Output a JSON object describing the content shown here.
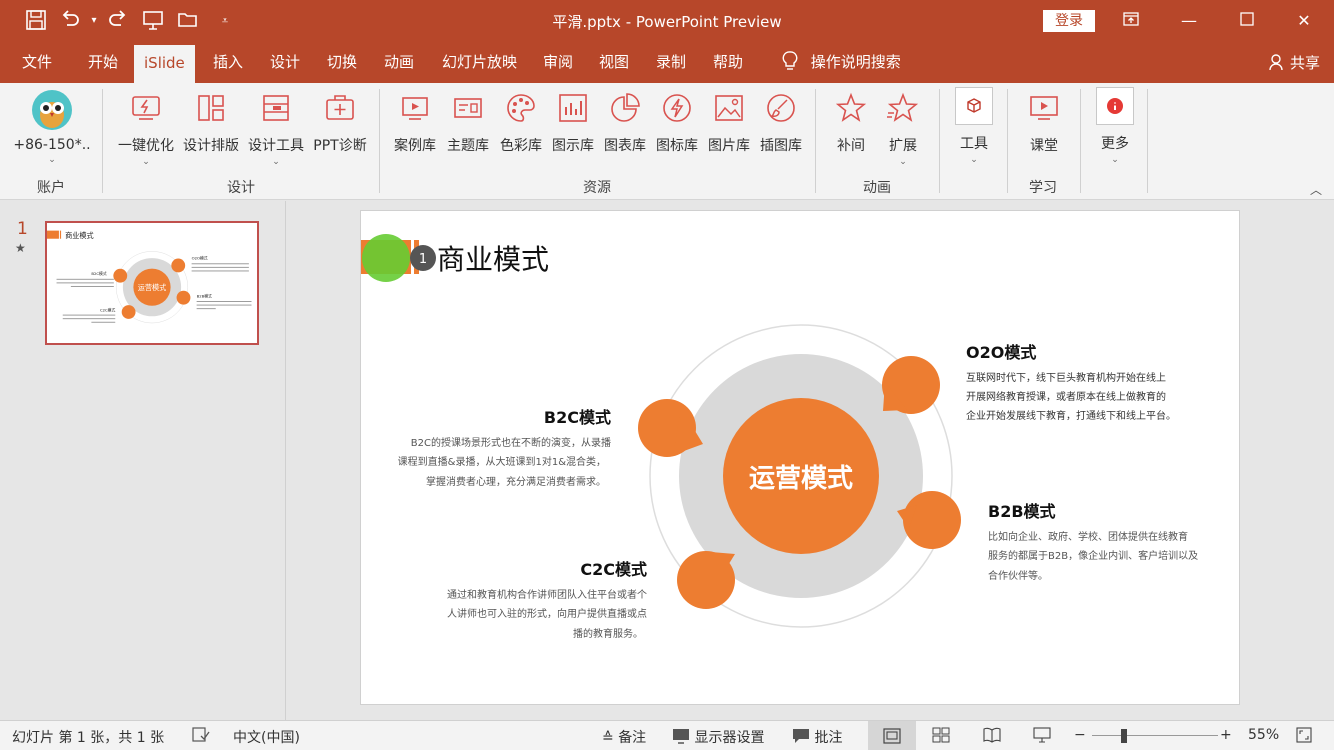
{
  "window": {
    "doc_title": "平滑.pptx  -  PowerPoint Preview",
    "login": "登录"
  },
  "tabs": [
    "文件",
    "开始",
    "iSlide",
    "插入",
    "设计",
    "切换",
    "动画",
    "幻灯片放映",
    "审阅",
    "视图",
    "录制",
    "帮助"
  ],
  "tell_me": "操作说明搜索",
  "share": "共享",
  "ribbon": {
    "account": {
      "label": "+86-150*..",
      "group": "账户"
    },
    "design": {
      "buttons": [
        "一键优化",
        "设计排版",
        "设计工具",
        "PPT诊断"
      ],
      "group": "设计"
    },
    "resources": {
      "buttons": [
        "案例库",
        "主题库",
        "色彩库",
        "图示库",
        "图表库",
        "图标库",
        "图片库",
        "插图库"
      ],
      "group": "资源"
    },
    "animation": {
      "buttons": [
        "补间",
        "扩展"
      ],
      "group": "动画"
    },
    "tools": {
      "label": "工具"
    },
    "learn": {
      "label": "课堂",
      "group": "学习"
    },
    "more": {
      "label": "更多"
    }
  },
  "thumbnail": {
    "number": "1",
    "title": "商业模式",
    "center": "运营模式",
    "labels": [
      "B2C模式",
      "O2O模式",
      "C2C模式",
      "B2B模式"
    ]
  },
  "slide": {
    "title": "商业模式",
    "anim_badge": "1",
    "center": "运营模式",
    "b2c": {
      "title": "B2C模式",
      "lines": [
        "B2C的授课场景形式也在不断的演变，从录播",
        "课程到直播&录播，从大班课到1对1&混合类，",
        "掌握消费者心理，充分满足消费者需求。"
      ]
    },
    "o2o": {
      "title": "O2O模式",
      "lines": [
        "互联网时代下，线下巨头教育机构开始在线上",
        "开展网络教育授课，或者原本在线上做教育的",
        "企业开始发展线下教育，打通线下和线上平台。"
      ]
    },
    "c2c": {
      "title": "C2C模式",
      "lines": [
        "通过和教育机构合作讲师团队入住平台或者个",
        "人讲师也可入驻的形式，向用户提供直播或点",
        "播的教育服务。"
      ]
    },
    "b2b": {
      "title": "B2B模式",
      "lines": [
        "比如向企业、政府、学校、团体提供在线教育",
        "服务的都属于B2B，像企业内训、客户培训以及",
        "合作伙伴等。"
      ]
    }
  },
  "status": {
    "slide_info": "幻灯片 第 1 张，共 1 张",
    "language": "中文(中国)",
    "notes": "备注",
    "display": "显示器设置",
    "comments": "批注",
    "zoom": "55%"
  },
  "colors": {
    "accent": "#b7472a",
    "orange": "#ed7d31",
    "gray_ring": "#d9d9d9"
  }
}
